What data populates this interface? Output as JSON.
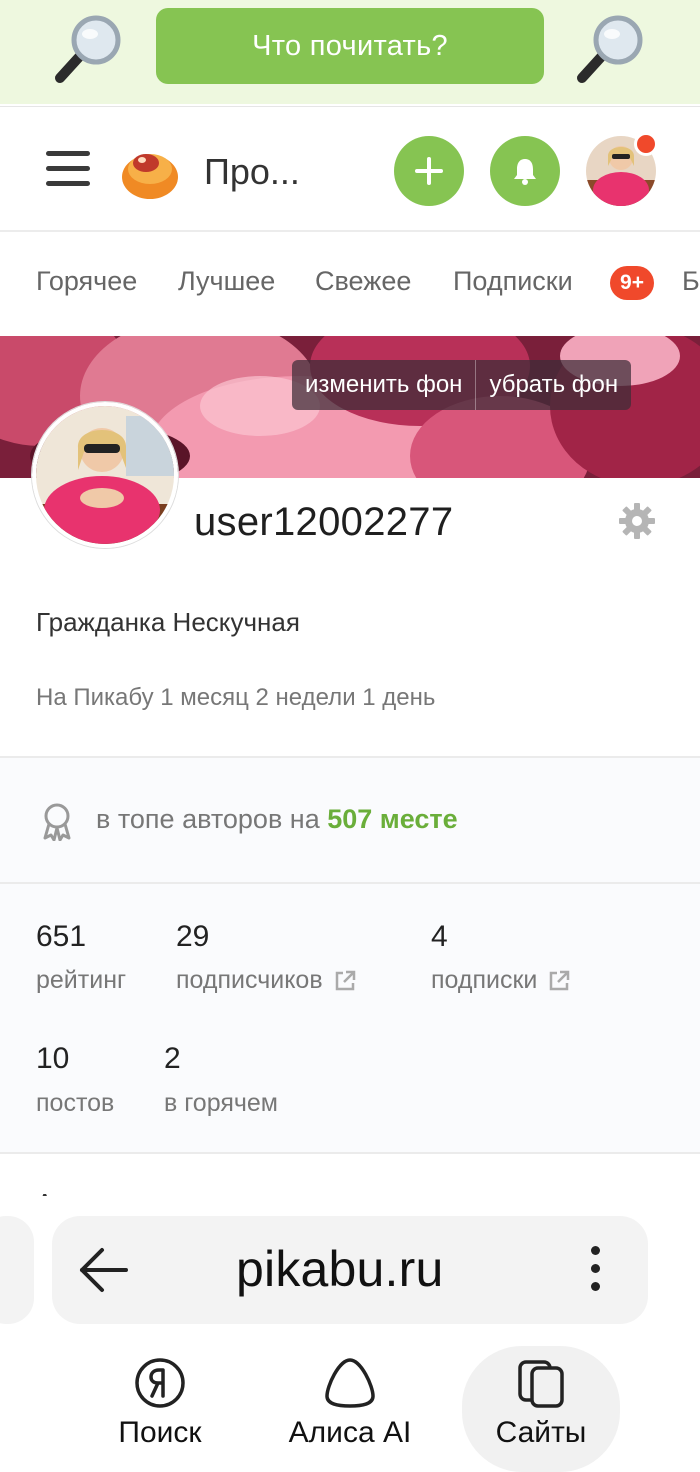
{
  "banner": {
    "cta_label": "Что почитать?",
    "left_icon": "magnifier-icon",
    "right_icon": "magnifier-icon",
    "accent": "#86c452"
  },
  "header": {
    "title": "Про...",
    "menu_icon": "menu-icon",
    "add_icon": "plus-icon",
    "bell_icon": "bell-icon"
  },
  "tabs": {
    "items": [
      "Горячее",
      "Лучшее",
      "Свежее",
      "Подписки",
      "Б"
    ],
    "subscriptions_badge": "9+"
  },
  "cover": {
    "change_label": "изменить фон",
    "remove_label": "убрать фон"
  },
  "profile": {
    "username": "user12002277",
    "subtitle": "Гражданка Нескучная",
    "since": "На Пикабу 1 месяц 2 недели 1 день",
    "rank_prefix": "в топе авторов на ",
    "rank_value": "507 месте"
  },
  "stats": {
    "rating_value": "651",
    "rating_label": "рейтинг",
    "followers_value": "29",
    "followers_label": "подписчиков",
    "subscriptions_value": "4",
    "subscriptions_label": "подписки",
    "posts_value": "10",
    "posts_label": "постов",
    "hot_value": "2",
    "hot_label": "в горячем"
  },
  "partial_text": "А",
  "browser": {
    "url": "pikabu.ru",
    "nav": [
      {
        "label": "Поиск",
        "icon": "yandex-icon"
      },
      {
        "label": "Алиса AI",
        "icon": "alice-icon"
      },
      {
        "label": "Сайты",
        "icon": "tabs-icon"
      }
    ]
  }
}
